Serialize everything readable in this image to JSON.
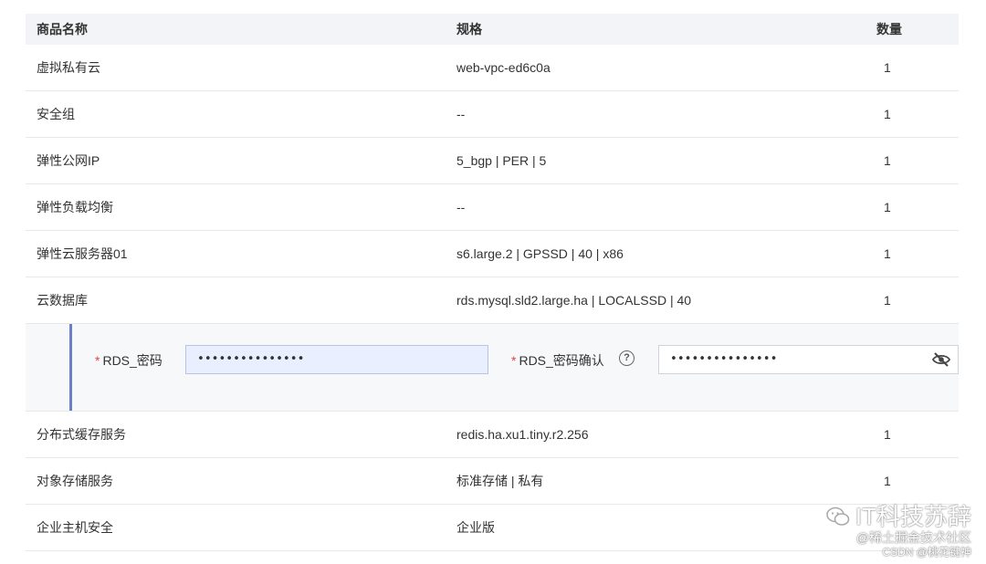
{
  "columns": {
    "name": "商品名称",
    "spec": "规格",
    "qty": "数量"
  },
  "rows_top": [
    {
      "name": "虚拟私有云",
      "spec": "web-vpc-ed6c0a",
      "qty": "1"
    },
    {
      "name": "安全组",
      "spec": "--",
      "qty": "1"
    },
    {
      "name": "弹性公网IP",
      "spec": "5_bgp | PER | 5",
      "qty": "1"
    },
    {
      "name": "弹性负载均衡",
      "spec": "--",
      "qty": "1"
    },
    {
      "name": "弹性云服务器01",
      "spec": "s6.large.2 | GPSSD | 40 | x86",
      "qty": "1"
    },
    {
      "name": "云数据库",
      "spec": "rds.mysql.sld2.large.ha | LOCALSSD | 40",
      "qty": "1"
    }
  ],
  "rds_form": {
    "required_mark": "*",
    "password_label": "RDS_密码",
    "password_value": "•••••••••••••••",
    "confirm_label": "RDS_密码确认",
    "help_glyph": "?",
    "confirm_value": "•••••••••••••••"
  },
  "rows_bottom": [
    {
      "name": "分布式缓存服务",
      "spec": "redis.ha.xu1.tiny.r2.256",
      "qty": "1"
    },
    {
      "name": "对象存储服务",
      "spec": "标准存储 | 私有",
      "qty": "1"
    },
    {
      "name": "企业主机安全",
      "spec": "企业版",
      "qty": ""
    }
  ],
  "watermark": {
    "title": "IT科技苏辞",
    "subtitle": "@稀土掘金技术社区",
    "csdn": "CSDN @桃花键神"
  },
  "icons": {
    "help": "help-circle-icon",
    "eye": "eye-off-icon",
    "logo": "wechat-logo-icon"
  }
}
